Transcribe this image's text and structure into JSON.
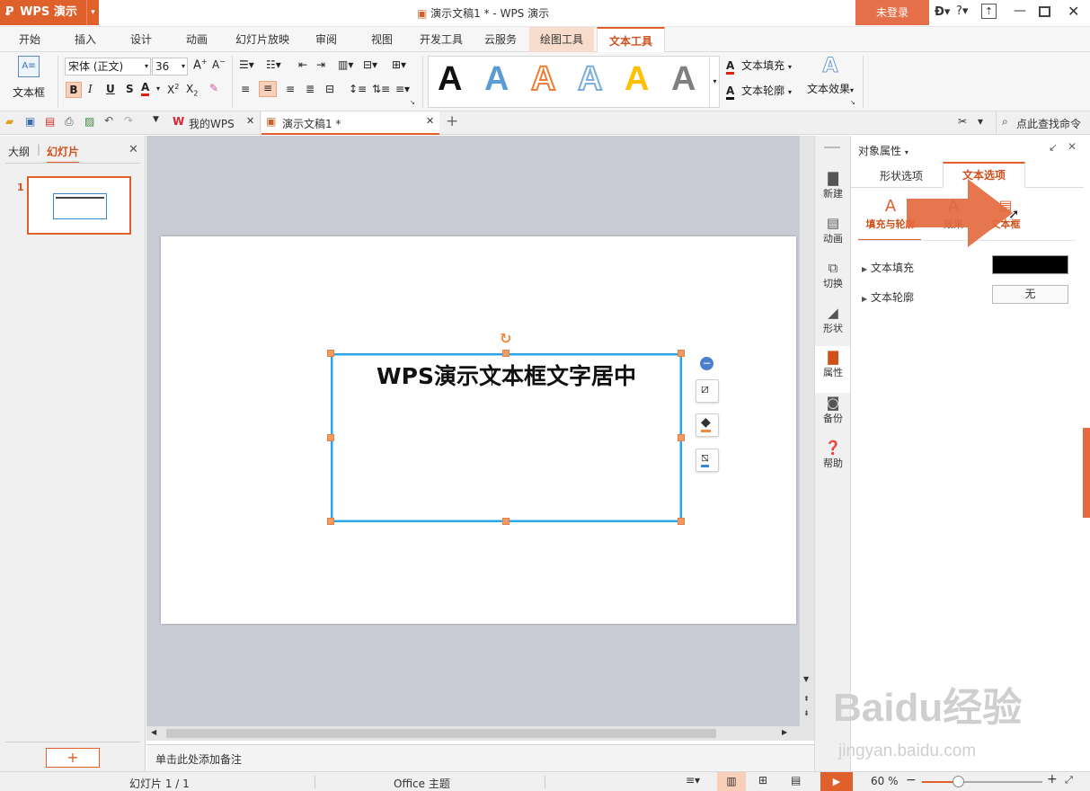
{
  "app": {
    "name": "WPS 演示",
    "window_title": "演示文稿1 * - WPS 演示",
    "login": "未登录",
    "brand_color": "#e0602b"
  },
  "menu": {
    "tabs": [
      "开始",
      "插入",
      "设计",
      "动画",
      "幻灯片放映",
      "审阅",
      "视图",
      "开发工具",
      "云服务",
      "绘图工具",
      "文本工具"
    ],
    "active": "文本工具"
  },
  "ribbon": {
    "textbox_label": "文本框",
    "font_name": "宋体 (正文)",
    "font_size": "36",
    "text_fill": "文本填充",
    "text_outline": "文本轮廓",
    "text_effect": "文本效果",
    "style_colors": [
      "#111111",
      "#5b9bd5",
      "#ed7d31",
      "#7aaedc",
      "#ffc000",
      "#7f7f7f"
    ],
    "style_letter": "A"
  },
  "doctabs": {
    "wps": "我的WPS",
    "doc": "演示文稿1 *",
    "search": "点此查找命令"
  },
  "leftpanel": {
    "tab_outline": "大纲",
    "tab_slides": "幻灯片",
    "slide_number": "1"
  },
  "slide": {
    "text": "WPS演示文本框文字居中"
  },
  "rail": {
    "items": [
      "新建",
      "动画",
      "切换",
      "形状",
      "属性",
      "备份",
      "帮助"
    ],
    "active": "属性"
  },
  "props": {
    "title": "对象属性",
    "tab_shape": "形状选项",
    "tab_text": "文本选项",
    "sub_fill": "填充与轮廓",
    "sub_effect": "效果",
    "sub_textbox": "文本框",
    "row_fill": "文本填充",
    "row_outline": "文本轮廓",
    "outline_value": "无",
    "fill_color": "#000000"
  },
  "notes": {
    "placeholder": "单击此处添加备注"
  },
  "status": {
    "slide_info": "幻灯片 1 / 1",
    "theme": "Office 主题",
    "zoom": "60 %",
    "zoom_fraction": 0.3
  },
  "watermark": {
    "brand": "Baidu经验",
    "url": "jingyan.baidu.com"
  }
}
